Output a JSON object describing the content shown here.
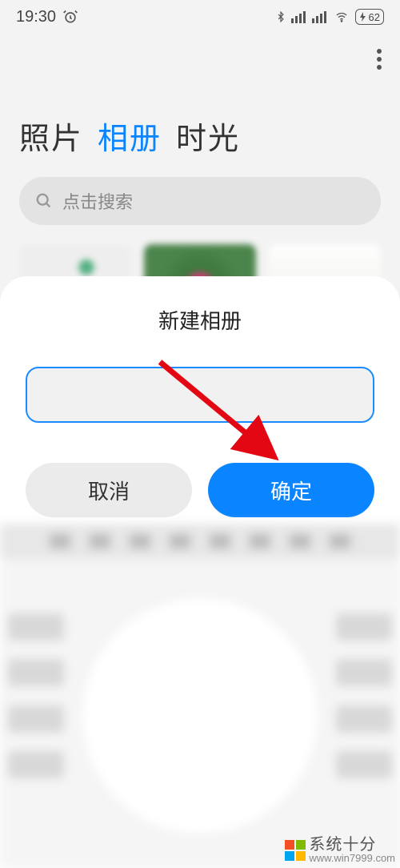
{
  "statusbar": {
    "time": "19:30",
    "battery": "62"
  },
  "tabs": [
    "照片",
    "相册",
    "时光"
  ],
  "active_tab_index": 1,
  "search": {
    "placeholder": "点击搜索"
  },
  "dialog": {
    "title": "新建相册",
    "input_value": "",
    "cancel_label": "取消",
    "ok_label": "确定"
  },
  "watermark": {
    "brand": "系统十分",
    "url": "www.win7999.com"
  }
}
